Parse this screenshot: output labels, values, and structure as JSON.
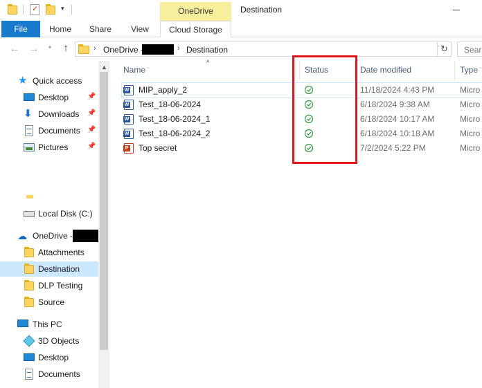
{
  "window": {
    "title": "Destination",
    "context_tab_group": "OneDrive"
  },
  "ribbon": {
    "tabs": [
      "File",
      "Home",
      "Share",
      "View",
      "Cloud Storage"
    ]
  },
  "address": {
    "crumbs": [
      "OneDrive -",
      "Destination"
    ],
    "search_placeholder": "Searc"
  },
  "navigation": {
    "quick_access": {
      "label": "Quick access",
      "items": [
        "Desktop",
        "Downloads",
        "Documents",
        "Pictures"
      ]
    },
    "local_disk": "Local Disk (C:)",
    "onedrive": {
      "label": "OneDrive -",
      "items": [
        "Attachments",
        "Destination",
        "DLP Testing",
        "Source"
      ],
      "selected": "Destination"
    },
    "this_pc": {
      "label": "This PC",
      "items": [
        "3D Objects",
        "Desktop",
        "Documents"
      ]
    }
  },
  "file_list": {
    "columns": [
      "Name",
      "Status",
      "Date modified",
      "Type"
    ],
    "files": [
      {
        "name": "MIP_apply_2",
        "date": "11/18/2024 4:43 PM",
        "type": "Micro",
        "icon": "word-icon",
        "status": "synced-check-icon"
      },
      {
        "name": "Test_18-06-2024",
        "date": "6/18/2024 9:38 AM",
        "type": "Micro",
        "icon": "word-icon",
        "status": "synced-check-icon"
      },
      {
        "name": "Test_18-06-2024_1",
        "date": "6/18/2024 10:17 AM",
        "type": "Micro",
        "icon": "word-icon",
        "status": "synced-check-icon"
      },
      {
        "name": "Test_18-06-2024_2",
        "date": "6/18/2024 10:18 AM",
        "type": "Micro",
        "icon": "word-icon",
        "status": "synced-check-icon"
      },
      {
        "name": "Top secret",
        "date": "7/2/2024 5:22 PM",
        "type": "Micro",
        "icon": "powerpoint-icon",
        "status": "synced-check-icon"
      }
    ]
  },
  "colors": {
    "file_tab": "#1979ca",
    "context_tab": "#f7ef9b",
    "selection": "#cce8ff",
    "sync_check": "#2e9b3f",
    "highlight_box": "#e0151e"
  }
}
